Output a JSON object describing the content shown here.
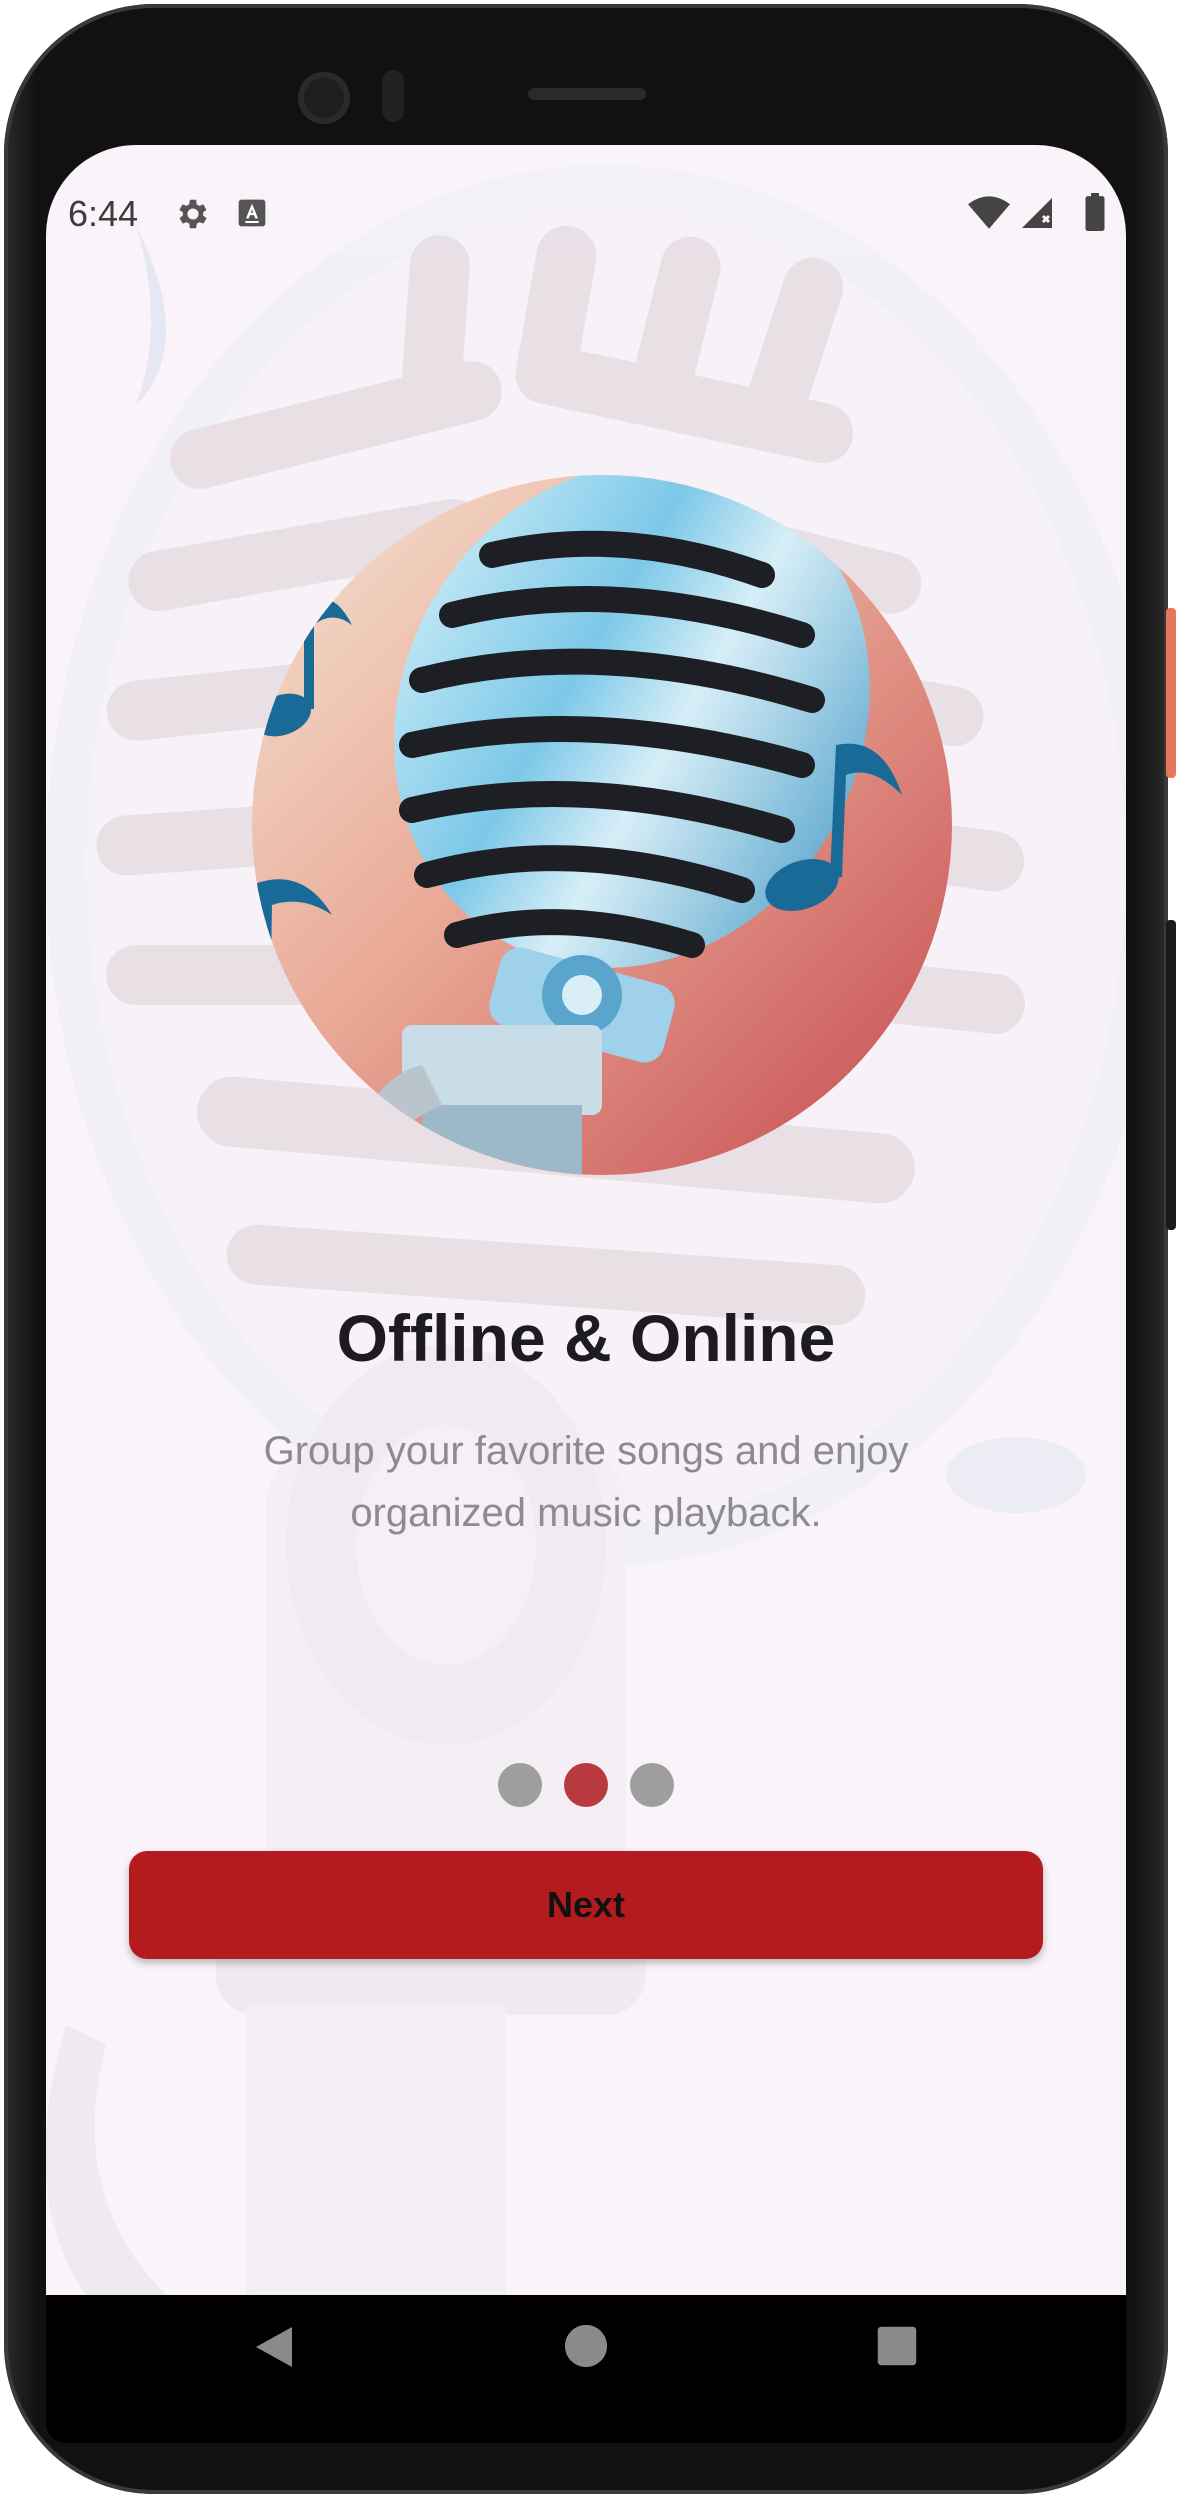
{
  "status_bar": {
    "time": "6:44",
    "left_icons": [
      "gear-icon",
      "keyboard-a-icon"
    ],
    "right_icons": [
      "wifi-icon",
      "signal-icon",
      "battery-icon"
    ]
  },
  "onboarding": {
    "title": "Offline & Online",
    "subtitle": "Group your favorite songs and enjoy organized music playback.",
    "page_count": 3,
    "active_page_index": 1,
    "next_label": "Next"
  },
  "navigation_bar": {
    "buttons": [
      "back-icon",
      "home-icon",
      "recents-icon"
    ]
  },
  "colors": {
    "accent": "#b31b1e",
    "active_dot": "#b83a3e",
    "inactive_dot": "#9e9e9e",
    "screen_background": "#faf3f9"
  }
}
